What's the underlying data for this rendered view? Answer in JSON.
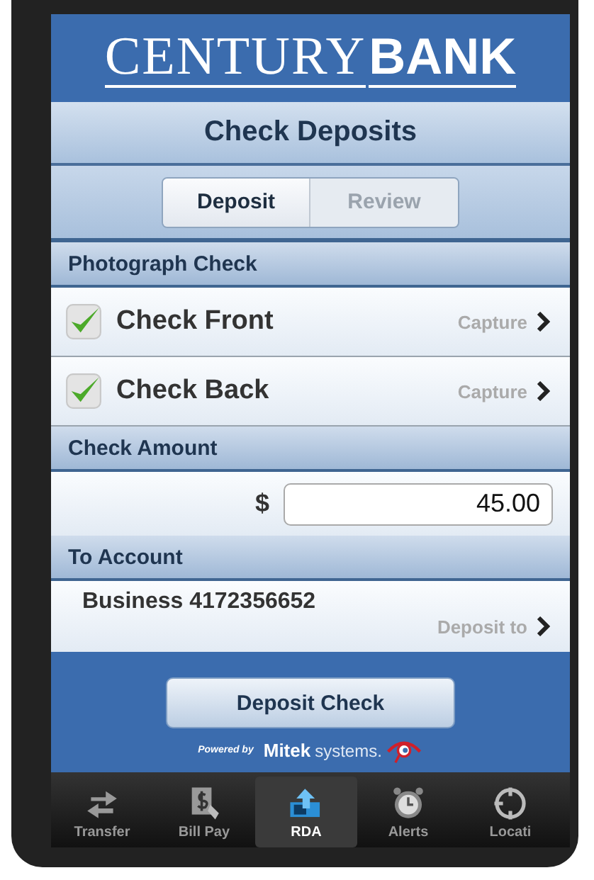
{
  "logo": {
    "part_1": "CENTURY",
    "part_2": "BANK"
  },
  "title": "Check Deposits",
  "segments": [
    {
      "label": "Deposit",
      "selected": true
    },
    {
      "label": "Review",
      "selected": false
    }
  ],
  "photograph_section": {
    "heading": "Photograph Check",
    "rows": [
      {
        "label": "Check Front",
        "checked": true,
        "action": "Capture"
      },
      {
        "label": "Check Back",
        "checked": true,
        "action": "Capture"
      }
    ]
  },
  "amount_section": {
    "heading": "Check Amount",
    "currency": "$",
    "value": "45.00"
  },
  "account_section": {
    "heading": "To Account",
    "account": "Business 4172356652",
    "action": "Deposit to"
  },
  "deposit_button": "Deposit Check",
  "powered_by": {
    "prefix": "Powered by",
    "brand_bold": "Mitek",
    "brand_light": "systems."
  },
  "tab_bar": [
    {
      "kind": "transfer",
      "label": "Transfer",
      "selected": false
    },
    {
      "kind": "billpay",
      "label": "Bill Pay",
      "selected": false
    },
    {
      "kind": "rda",
      "label": "RDA",
      "selected": true
    },
    {
      "kind": "alerts",
      "label": "Alerts",
      "selected": false
    },
    {
      "kind": "locations",
      "label": "Locati",
      "selected": false
    }
  ]
}
